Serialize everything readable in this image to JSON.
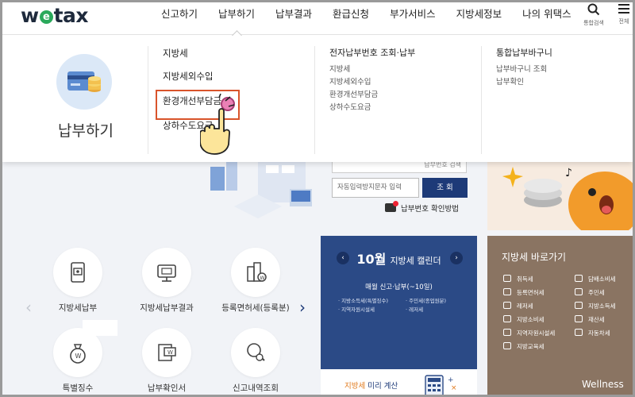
{
  "header": {
    "logo": {
      "w": "w",
      "e": "e",
      "tax": "tax"
    },
    "nav": [
      "신고하기",
      "납부하기",
      "납부결과",
      "환급신청",
      "부가서비스",
      "지방세정보",
      "나의 위택스"
    ],
    "active_nav": 1,
    "search_label": "통합검색",
    "menu_label": "전체"
  },
  "mega_menu": {
    "title": "납부하기",
    "col1": [
      "지방세",
      "지방세외수입",
      "환경개선부담금",
      "상하수도요금"
    ],
    "col2": {
      "head": "전자납부번호 조회·납부",
      "items": [
        "지방세",
        "지방세외수입",
        "환경개선부담금",
        "상하수도요금"
      ]
    },
    "col3": {
      "head": "통합납부바구니",
      "items": [
        "납부바구니 조회",
        "납부확인"
      ]
    },
    "highlighted_item": "환경개선부담금"
  },
  "search_box": {
    "top_field_hint": "납부번호 검색",
    "captcha_placeholder": "자동입력방지문자 입력",
    "submit_label": "조 회",
    "help_link": "납부번호 확인방법"
  },
  "quick_tiles": [
    {
      "label": "지방세납부",
      "icon": "tax-payment-icon"
    },
    {
      "label": "지방세납부결과",
      "icon": "payment-result-icon"
    },
    {
      "label": "등록면허세(등록분)",
      "icon": "building-tax-icon"
    },
    {
      "label": "특별징수",
      "icon": "money-bag-icon"
    },
    {
      "label": "납부확인서",
      "icon": "receipt-icon"
    },
    {
      "label": "신고내역조회",
      "icon": "magnifier-icon"
    }
  ],
  "calendar": {
    "month": "10월",
    "title": "지방세 캘린더",
    "subtitle": "매월 신고·납부(~10일)",
    "items": [
      "지방소득세(특별징수)",
      "주민세(종업원분)",
      "지역자원시설세",
      "레저세"
    ],
    "bottom_highlight": "지방세",
    "bottom_text": " 미리 계산"
  },
  "shortcuts": {
    "title": "지방세 바로가기",
    "items": [
      "취득세",
      "담배소비세",
      "등록면허세",
      "주민세",
      "레저세",
      "지방소득세",
      "지방소비세",
      "재산세",
      "지역자원시설세",
      "자동차세",
      "지방교육세"
    ]
  },
  "watermark": "Wellness",
  "colors": {
    "navy": "#2b4a86",
    "highlight": "#d9542b",
    "shortcut_bg": "#8a7462",
    "brand_green": "#2aa95b"
  }
}
